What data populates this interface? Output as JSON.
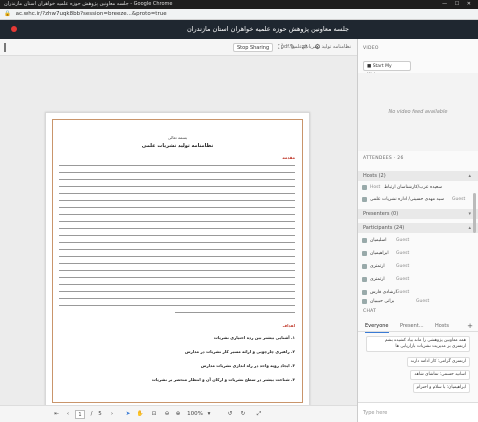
{
  "browser": {
    "title": "جلسه معاونین پژوهش حوزه علمیه خواهران استان مازندران - Google Chrome",
    "url": "ac.whc.ir/?zhw7uqk8bb?session=breeze...&proto=true",
    "window_controls": "— ☐ ✕"
  },
  "meeting": {
    "title": "جلسه معاونین پژوهش حوزه علمیه خواهران استان مازندران"
  },
  "presentation": {
    "doc_name": "نظامنامه تولید نشریات علمی.pdf",
    "stop_sharing_label": "Stop Sharing",
    "page_current": "1",
    "page_separator": "/",
    "page_total": "5",
    "zoom": "100%",
    "slide": {
      "header": "بسمه تعالی",
      "title": "نظامنامه تولید نشریات علمی",
      "section1": "مقدمه",
      "section2": "اهداف",
      "goals": [
        "۱. آشنایی بیشتر بین رده اختیاری نشریات",
        "۲. راهبری چارچوبی و ارائه مسیر کار نشریات در مدارس",
        "۳. ایجاد رویه واحد در راه اندازی نشریات مدارس",
        "۴. شناخت بیشتر در سطح نشریات و ارکان آن و انتظار منحصر بر نشریات"
      ]
    }
  },
  "panel": {
    "video_heading": "VIDEO",
    "webcam_label": "Start My Webcam",
    "no_video_text": "No video feed available",
    "attendees_heading": "ATTENDEES",
    "attendees_count": "26",
    "groups": [
      {
        "label": "Hosts",
        "count": "(2)"
      },
      {
        "label": "Presenters",
        "count": "(0)"
      },
      {
        "label": "Participants",
        "count": "(24)"
      }
    ],
    "hosts": [
      {
        "name": "سعیده عرب/کارشناسان ارتباط",
        "role": "Host"
      },
      {
        "name": "سید مهدی حسینی/ اداره نشریات علمی",
        "role": "Guest"
      }
    ],
    "participants": [
      {
        "name": "اسلیمیان",
        "role": "Guest"
      },
      {
        "name": "ابراهیمیان",
        "role": "Guest"
      },
      {
        "name": "ارتمتری",
        "role": "Guest"
      },
      {
        "name": "ارتمتری",
        "role": "Guest"
      },
      {
        "name": "ارشادی فارس",
        "role": "Guest"
      },
      {
        "name": "براتی حبیبیان",
        "role": "Guest"
      }
    ],
    "chat_heading": "CHAT",
    "chat_tabs": [
      "Everyone",
      "Present...",
      "Hosts"
    ],
    "messages": [
      "همه معاونین پژوهشی را ماند بیاد کشیده بشم ارتمتری بر مدیریت نشریات بازاریابی ها",
      "ارتمتری گرامی: کار ادامه دارند",
      "اساتید حسمی: تماشای شاهد",
      "ابراهیمیان: با سلام و احترام"
    ],
    "type_here": "Type here"
  },
  "icons": {
    "rec": "record-dot",
    "collapse": "collapse-icon"
  }
}
